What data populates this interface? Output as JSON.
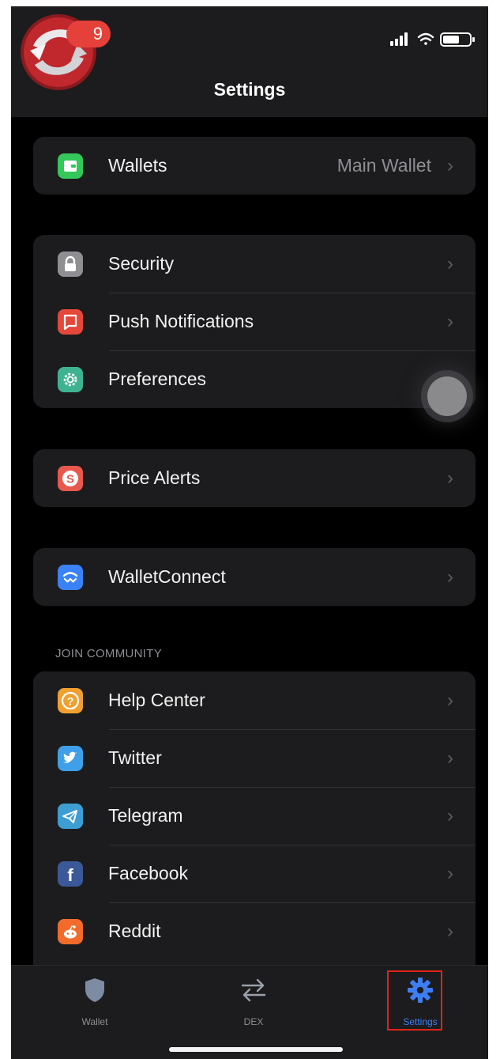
{
  "status_bar": {
    "badge": "9"
  },
  "nav": {
    "title": "Settings"
  },
  "groups": [
    {
      "items": [
        {
          "label": "Wallets",
          "value": "Main Wallet",
          "icon": "wallet-icon",
          "color": "#34c759"
        }
      ]
    },
    {
      "items": [
        {
          "label": "Security",
          "value": "",
          "icon": "lock-icon",
          "color": "#8e8e93"
        },
        {
          "label": "Push Notifications",
          "value": "",
          "icon": "notification-icon",
          "color": "#e5473a"
        },
        {
          "label": "Preferences",
          "value": "",
          "icon": "gear-icon",
          "color": "#3fb391"
        }
      ]
    },
    {
      "items": [
        {
          "label": "Price Alerts",
          "value": "",
          "icon": "dollar-icon",
          "color": "#e8584e"
        }
      ]
    },
    {
      "items": [
        {
          "label": "WalletConnect",
          "value": "",
          "icon": "walletconnect-icon",
          "color": "#3b82f6"
        }
      ]
    }
  ],
  "community": {
    "header": "JOIN COMMUNITY",
    "items": [
      {
        "label": "Help Center",
        "icon": "help-icon",
        "color": "#f0a030"
      },
      {
        "label": "Twitter",
        "icon": "twitter-icon",
        "color": "#3f9fe8"
      },
      {
        "label": "Telegram",
        "icon": "telegram-icon",
        "color": "#3d9ed4"
      },
      {
        "label": "Facebook",
        "icon": "facebook-icon",
        "color": "#3b5998"
      },
      {
        "label": "Reddit",
        "icon": "reddit-icon",
        "color": "#f26b2a"
      }
    ]
  },
  "tabbar": {
    "tabs": [
      {
        "label": "Wallet",
        "icon": "shield-icon",
        "active": false
      },
      {
        "label": "DEX",
        "icon": "swap-arrows-icon",
        "active": false
      },
      {
        "label": "Settings",
        "icon": "gear-icon",
        "active": true
      }
    ]
  },
  "colors": {
    "accent": "#3e7ef5",
    "highlight": "#e2231a",
    "background": "#000000",
    "card": "#1c1c1e"
  }
}
